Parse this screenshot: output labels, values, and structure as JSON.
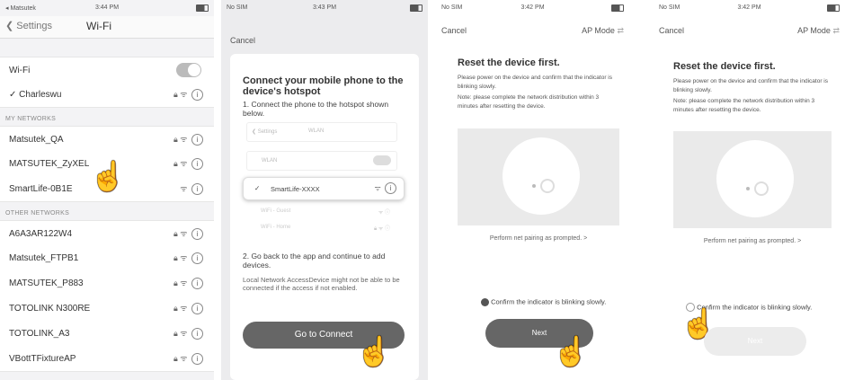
{
  "p1": {
    "status": {
      "carrier": "◂ Matsutek",
      "time": "3:44 PM"
    },
    "nav": {
      "back": "Settings",
      "title": "Wi-Fi"
    },
    "wifi_label": "Wi-Fi",
    "connected": "Charleswu",
    "my_networks_header": "MY NETWORKS",
    "my_networks": [
      "Matsutek_QA",
      "MATSUTEK_ZyXEL",
      "SmartLife-0B1E"
    ],
    "other_networks_header": "OTHER NETWORKS",
    "other_networks": [
      "A6A3AR122W4",
      "Matsutek_FTPB1",
      "MATSUTEK_P883",
      "TOTOLINK N300RE",
      "TOTOLINK_A3",
      "VBottTFixtureAP"
    ]
  },
  "p2": {
    "status": {
      "carrier": "No SIM",
      "time": "3:43 PM"
    },
    "cancel": "Cancel",
    "title": "Connect your mobile phone to the device's hotspot",
    "step1": "1. Connect the phone to the hotspot shown below.",
    "mock": {
      "back": "Settings",
      "title": "WLAN",
      "wlan": "WLAN",
      "network": "SmartLife-XXXX",
      "guest": "WiFi - Guest",
      "home": "WiFi - Home"
    },
    "step2": "2. Go back to the app and continue to add devices.",
    "note": "Local Network AccessDevice might not be able to be connected if the access if not enabled.",
    "button": "Go to Connect"
  },
  "p3": {
    "status": {
      "carrier": "No SIM",
      "time": "3:42 PM"
    },
    "cancel": "Cancel",
    "mode": "AP Mode",
    "title": "Reset the device first.",
    "desc1": "Please power on the device and confirm that the indicator is blinking slowly.",
    "desc2": "Note: please complete the network distribution within 3 minutes after resetting the device.",
    "prompt": "Perform net pairing as prompted. >",
    "confirm": "Confirm the indicator is blinking slowly.",
    "button": "Next"
  },
  "p4": {
    "status": {
      "carrier": "No SIM",
      "time": "3:42 PM"
    },
    "cancel": "Cancel",
    "mode": "AP Mode",
    "title": "Reset the device first.",
    "desc1": "Please power on the device and confirm that the indicator is blinking slowly.",
    "desc2": "Note: please complete the network distribution within 3 minutes after resetting the device.",
    "prompt": "Perform net pairing as prompted. >",
    "confirm": "Confirm the indicator is blinking slowly.",
    "button": "Next"
  }
}
